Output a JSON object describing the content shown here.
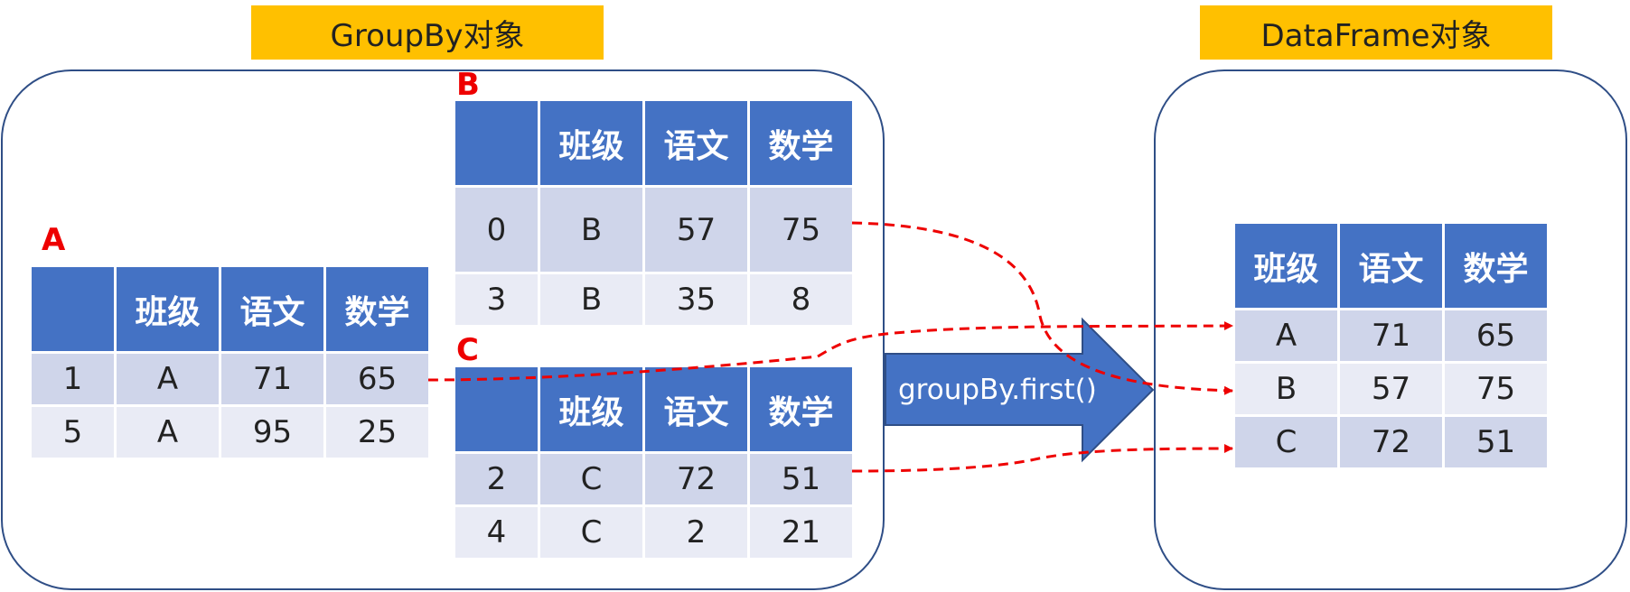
{
  "titles": {
    "groupby": "GroupBy对象",
    "dataframe": "DataFrame对象"
  },
  "groups": {
    "A": {
      "label": "A",
      "header": [
        "",
        "班级",
        "语文",
        "数学"
      ],
      "rows": [
        [
          "1",
          "A",
          "71",
          "65"
        ],
        [
          "5",
          "A",
          "95",
          "25"
        ]
      ]
    },
    "B": {
      "label": "B",
      "header": [
        "",
        "班级",
        "语文",
        "数学"
      ],
      "rows": [
        [
          "0",
          "B",
          "57",
          "75"
        ],
        [
          "3",
          "B",
          "35",
          "8"
        ]
      ]
    },
    "C": {
      "label": "C",
      "header": [
        "",
        "班级",
        "语文",
        "数学"
      ],
      "rows": [
        [
          "2",
          "C",
          "72",
          "51"
        ],
        [
          "4",
          "C",
          "2",
          "21"
        ]
      ]
    }
  },
  "result": {
    "header": [
      "班级",
      "语文",
      "数学"
    ],
    "rows": [
      [
        "A",
        "71",
        "65"
      ],
      [
        "B",
        "57",
        "75"
      ],
      [
        "C",
        "72",
        "51"
      ]
    ]
  },
  "arrow": {
    "label": "groupBy.first()"
  },
  "colors": {
    "header": "#4472C4",
    "row_a": "#CFD5EA",
    "row_b": "#E9EBF5",
    "title_bg": "#FFC000",
    "connector": "#EE0000",
    "panel_border": "#2F4E86"
  }
}
